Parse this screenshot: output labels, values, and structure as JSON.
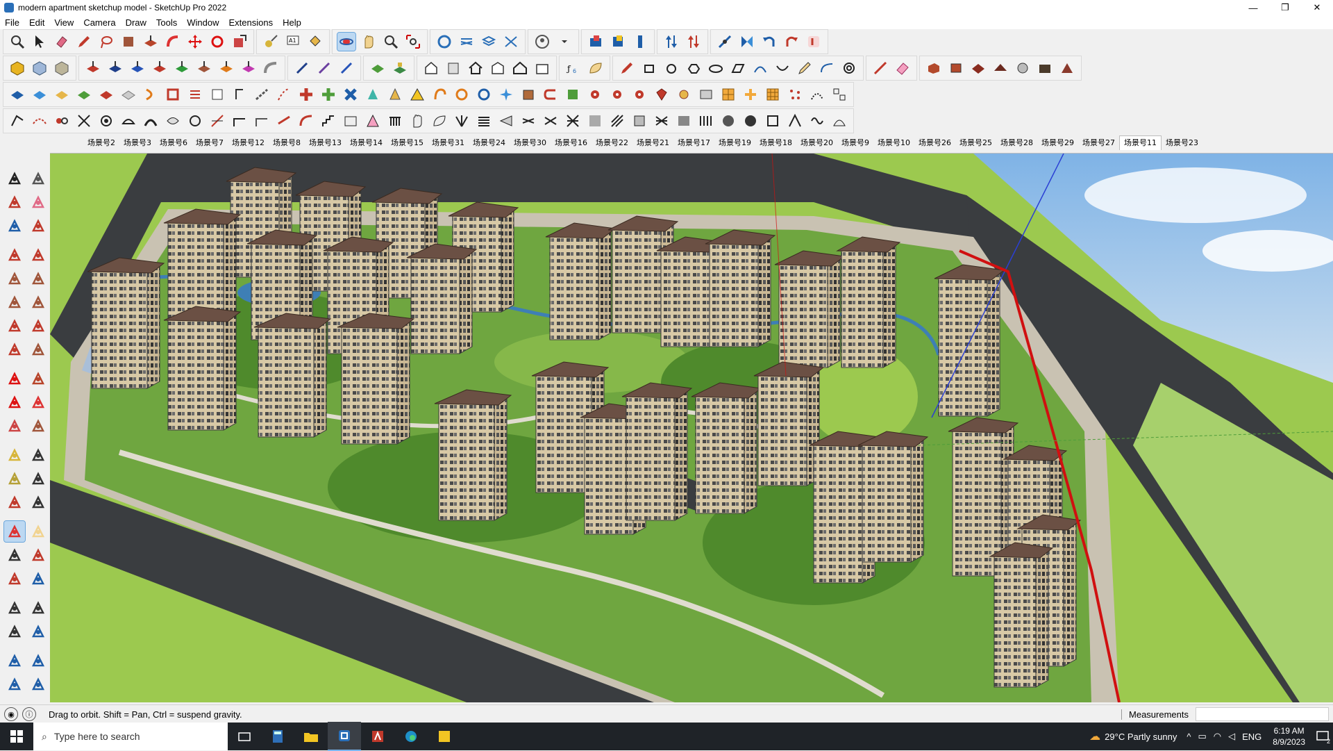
{
  "window": {
    "title": "modern apartment sketchup model - SketchUp Pro 2022",
    "minimize": "—",
    "restore": "❐",
    "close": "✕"
  },
  "menu": [
    "File",
    "Edit",
    "View",
    "Camera",
    "Draw",
    "Tools",
    "Window",
    "Extensions",
    "Help"
  ],
  "scenes": {
    "tabs": [
      "场景号2",
      "场景号3",
      "场景号6",
      "场景号7",
      "场景号12",
      "场景号8",
      "场景号13",
      "场景号14",
      "场景号15",
      "场景号31",
      "场景号24",
      "场景号30",
      "场景号16",
      "场景号22",
      "场景号21",
      "场景号17",
      "场景号19",
      "场景号18",
      "场景号20",
      "场景号9",
      "场景号10",
      "场景号26",
      "场景号25",
      "场景号28",
      "场景号29",
      "场景号27",
      "场景号11",
      "场景号23"
    ],
    "active": "场景号11"
  },
  "status": {
    "message": "Drag to orbit. Shift = Pan, Ctrl = suspend gravity.",
    "measurements_label": "Measurements",
    "measurements_value": ""
  },
  "taskbar": {
    "search_placeholder": "Type here to search",
    "weather": "29°C  Partly sunny",
    "language": "ENG",
    "time": "6:19 AM",
    "date": "8/9/2023",
    "notification_count": "2"
  },
  "colors": {
    "grass_light": "#9cc94f",
    "grass_dark": "#4f8a2c",
    "road": "#3a3d40",
    "pavement": "#d4cfc2",
    "roof": "#6b5044",
    "facade": "#d8c9a6",
    "water": "#3e7fb5",
    "selection": "#bcd8f2",
    "red_axis": "#d01010",
    "blue_axis": "#2b3fd4"
  },
  "icons": {
    "toolbar_row1": [
      "zoom-icon",
      "select-icon",
      "eraser-icon",
      "pencil-icon",
      "lasso-icon",
      "paint-icon",
      "push-pull-icon",
      "follow-me-icon",
      "move-icon",
      "rotate-icon",
      "scale-icon",
      "tape-icon",
      "text-icon",
      "paint-bucket-icon",
      "orbit-icon",
      "pan-icon",
      "zoom-window-icon",
      "zoom-extents-icon",
      "section-icon",
      "layers-icon",
      "styles-icon",
      "scenes-icon",
      "user-icon",
      "warehouse-icon",
      "ext-warehouse-icon",
      "model-info-icon",
      "axes-icon",
      "dimension-icon",
      "clipboard-icon",
      "undo-icon",
      "redo-icon",
      "help-icon"
    ],
    "left_tools": [
      "select-icon",
      "orbit-small-icon",
      "paint-bucket-icon",
      "eraser-icon",
      "component-icon",
      "pencil-icon",
      "line-icon",
      "freehand-icon",
      "rectangle-icon",
      "rotated-rect-icon",
      "circle-icon",
      "polygon-icon",
      "arc-icon",
      "pie-icon",
      "arc3-icon",
      "arc2-icon",
      "move-icon",
      "push-pull-icon",
      "rotate-icon",
      "follow-me-icon",
      "scale-icon",
      "offset-icon",
      "tape-icon",
      "text-icon",
      "protractor-icon",
      "dimension-icon",
      "axes-icon",
      "3dtext-icon",
      "orbit-icon",
      "pan-icon",
      "zoom-icon",
      "zoom-window-icon",
      "zoom-extents-icon",
      "prev-icon",
      "walk-icon",
      "look-around-icon",
      "position-camera-icon",
      "section-plane-icon",
      "sandbox-icon",
      "sandbox2-icon",
      "stamp-icon",
      "drape-icon"
    ]
  }
}
